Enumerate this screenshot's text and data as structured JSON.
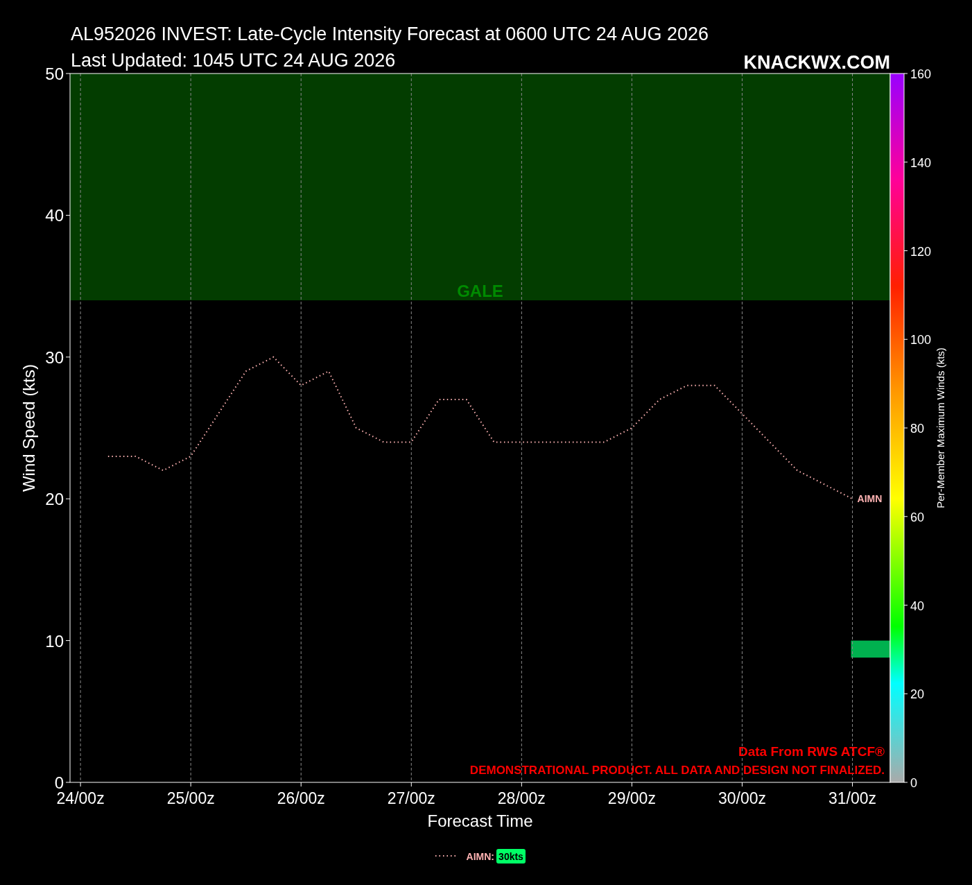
{
  "title": "AL952026 INVEST: Late-Cycle Intensity Forecast at 0600 UTC 24 AUG 2026",
  "subtitle": "Last Updated: 1045 UTC 24 AUG 2026",
  "brand": "KNACKWX.COM",
  "chart_data": {
    "type": "line",
    "xlabel": "Forecast Time",
    "ylabel": "Wind Speed (kts)",
    "categories": [
      "24/00z",
      null,
      null,
      null,
      "25/00z",
      null,
      null,
      null,
      "26/00z",
      null,
      null,
      null,
      "27/00z",
      null,
      null,
      null,
      "28/00z",
      null,
      null,
      null,
      "29/00z",
      null,
      null,
      null,
      "30/00z",
      null,
      null,
      null,
      "31/00z"
    ],
    "series": [
      {
        "name": "AIMN",
        "color": "#ffb3b3",
        "line_style": "dotted",
        "values": [
          null,
          23,
          23,
          22,
          23,
          26,
          29,
          30,
          28,
          29,
          25,
          24,
          24,
          27,
          27,
          24,
          24,
          24,
          24,
          24,
          25,
          27,
          28,
          28,
          26,
          24,
          22,
          21,
          20
        ]
      }
    ],
    "ylim": [
      0,
      50
    ],
    "grid": true,
    "yticks": [
      0,
      10,
      20,
      30,
      40,
      50
    ]
  },
  "overlays": [
    {
      "kind": "band",
      "label": "GALE",
      "color": "#033d00"
    },
    {
      "kind": "bar",
      "color": "#00b14f"
    }
  ],
  "colorbar": {
    "label": "Per-Member Maximum Winds (kts)",
    "ticks": [
      "160",
      "140",
      "120",
      "100",
      "80",
      "60",
      "40",
      "20",
      "0"
    ]
  },
  "notes": [
    "Data From RWS ATCF®",
    "DEMONSTRATIONAL PRODUCT. ALL DATA AND DESIGN NOT FINALIZED."
  ],
  "legend": [
    {
      "name": "AIMN:",
      "value": "30kts",
      "color": "#00ff66"
    }
  ]
}
